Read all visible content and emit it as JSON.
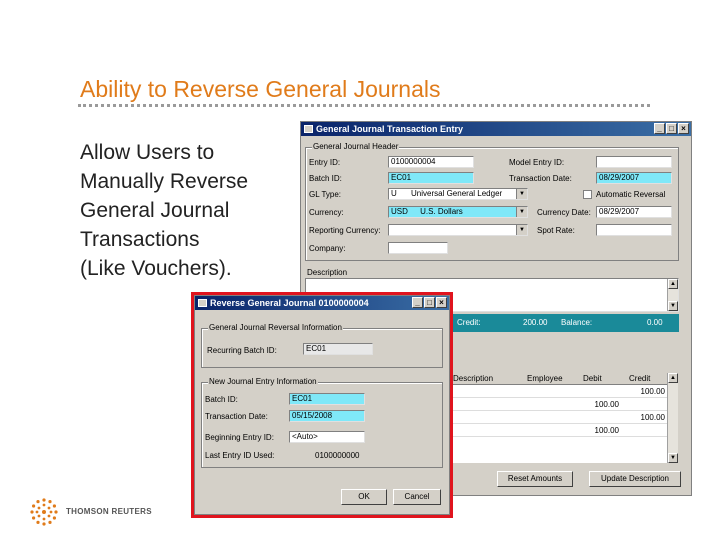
{
  "slide": {
    "title": "Ability to Reverse General Journals",
    "body_lines": [
      "Allow Users to",
      "Manually Reverse",
      "General Journal",
      "Transactions",
      "(Like Vouchers)."
    ]
  },
  "gj_window": {
    "title": "General Journal Transaction Entry",
    "header_group": "General Journal Header",
    "entry_id_label": "Entry ID:",
    "entry_id_value": "0100000004",
    "batch_id_label": "Batch ID:",
    "batch_id_value": "EC01",
    "gl_type_label": "GL Type:",
    "gl_type_value": "U",
    "gl_type_desc": "Universal General Ledger",
    "currency_label": "Currency:",
    "currency_value": "USD",
    "currency_desc": "U.S. Dollars",
    "reporting_currency_label": "Reporting Currency:",
    "company_label": "Company:",
    "model_entry_label": "Model Entry ID:",
    "transaction_date_label": "Transaction Date:",
    "transaction_date_value": "08/29/2007",
    "auto_reversal_label": "Automatic Reversal",
    "currency_date_label": "Currency Date:",
    "currency_date_value": "08/29/2007",
    "spot_rate_label": "Spot Rate:",
    "description_label": "Description",
    "totals_credit_label": "Credit:",
    "totals_credit_value": "200.00",
    "totals_balance_label": "Balance:",
    "totals_balance_value": "0.00",
    "grid_headers": [
      "Description",
      "Employee",
      "Debit",
      "Credit"
    ],
    "grid_rows": [
      {
        "debit": "",
        "credit": "100.00"
      },
      {
        "debit": "100.00",
        "credit": ""
      },
      {
        "debit": "",
        "credit": "100.00"
      },
      {
        "debit": "100.00",
        "credit": ""
      }
    ],
    "btn_reset": "Reset Amounts",
    "btn_update": "Update Description"
  },
  "rev_window": {
    "title": "Reverse General Journal 0100000004",
    "orig_group": "General Journal Reversal Information",
    "recurring_batch_label": "Recurring Batch ID:",
    "recurring_batch_value": "EC01",
    "new_group": "New Journal Entry Information",
    "batch_id_label": "Batch ID:",
    "batch_id_value": "EC01",
    "transaction_date_label": "Transaction Date:",
    "transaction_date_value": "05/15/2008",
    "beginning_entry_label": "Beginning Entry ID:",
    "beginning_entry_value": "<Auto>",
    "last_entry_label": "Last Entry ID Used:",
    "last_entry_value": "0100000000",
    "ok_label": "OK",
    "cancel_label": "Cancel"
  },
  "footer": {
    "brand": "THOMSON REUTERS"
  },
  "colors": {
    "title_orange": "#e07b1a",
    "highlight_red": "#e0141e",
    "field_cyan": "#7fe8f8",
    "titlebar_blue": "#0a246a"
  }
}
